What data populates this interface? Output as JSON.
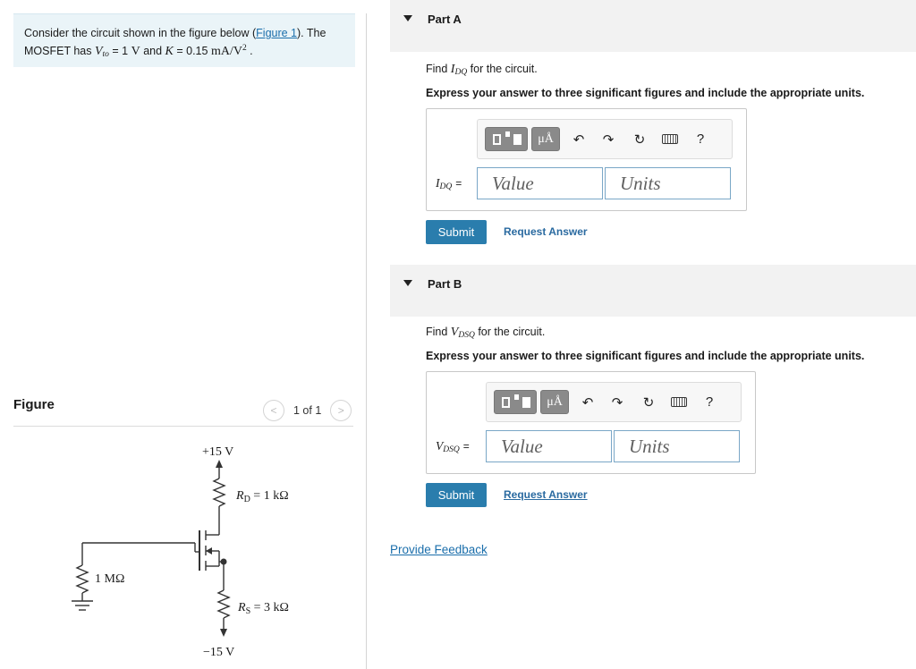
{
  "problem": {
    "text_1": "Consider the circuit shown in the figure below (",
    "figure_link": "Figure 1",
    "text_2": "). The MOSFET has ",
    "vto_var": "V",
    "vto_sub": "to",
    "vto_val": " = 1 ",
    "vto_unit": "V",
    "and": " and ",
    "k_var": "K",
    "k_val": " = 0.15 ",
    "k_unit": "mA/V",
    "k_sup": "2",
    "period": " ."
  },
  "figure": {
    "title": "Figure",
    "pager_prev": "<",
    "pager_next": ">",
    "pager_count": "1 of 1"
  },
  "circuit": {
    "vdd": "+15 V",
    "rd_var": "R",
    "rd_sub": "D",
    "rd_val": " = 1 kΩ",
    "rg": "1 MΩ",
    "rs_var": "R",
    "rs_sub": "S",
    "rs_val": " = 3 kΩ",
    "vss": "−15 V"
  },
  "toolbar": {
    "units_symbol": "μÅ",
    "undo": "↶",
    "redo": "↷",
    "reset": "↻",
    "help": "?"
  },
  "part_a": {
    "title": "Part A",
    "find_prefix": "Find ",
    "var": "I",
    "var_sub": "DQ",
    "find_suffix": " for the circuit.",
    "express": "Express your answer to three significant figures and include the appropriate units.",
    "label_var": "I",
    "label_sub": "DQ",
    "label_eq": "=",
    "value_placeholder": "Value",
    "units_placeholder": "Units",
    "submit": "Submit",
    "request": "Request Answer"
  },
  "part_b": {
    "title": "Part B",
    "find_prefix": "Find ",
    "var": "V",
    "var_sub": "DSQ",
    "find_suffix": " for the circuit.",
    "express": "Express your answer to three significant figures and include the appropriate units.",
    "label_var": "V",
    "label_sub": "DSQ",
    "label_eq": "=",
    "value_placeholder": "Value",
    "units_placeholder": "Units",
    "submit": "Submit",
    "request": "Request Answer"
  },
  "feedback": "Provide Feedback"
}
